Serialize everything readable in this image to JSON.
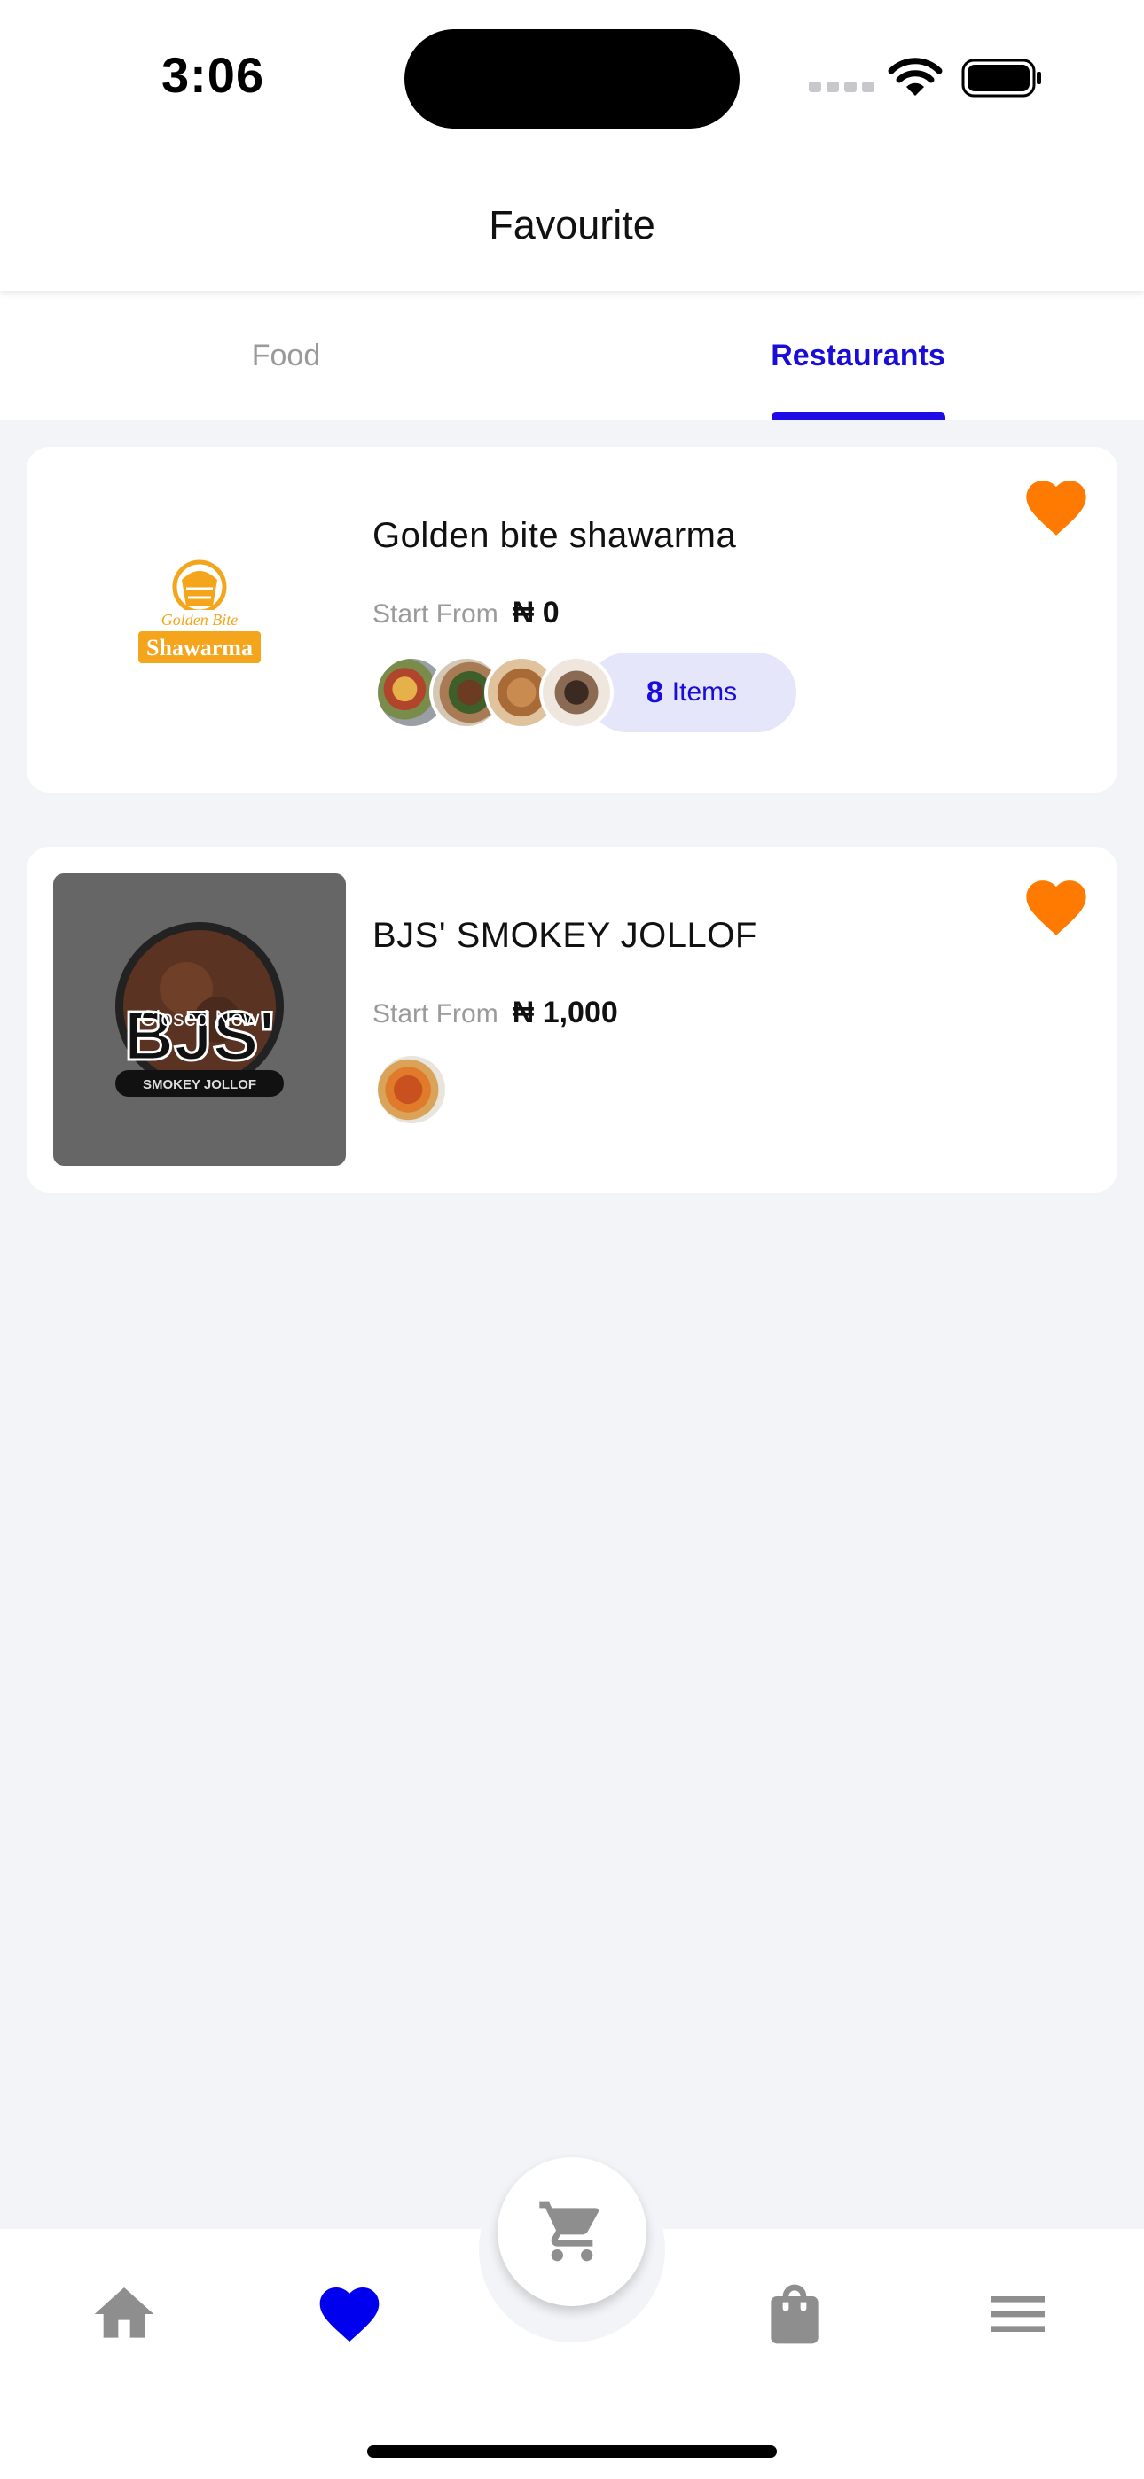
{
  "status_bar": {
    "time": "3:06"
  },
  "header": {
    "title": "Favourite"
  },
  "tabs": [
    {
      "label": "Food",
      "active": false
    },
    {
      "label": "Restaurants",
      "active": true
    }
  ],
  "restaurants": [
    {
      "name": "Golden bite shawarma",
      "start_label": "Start From",
      "price": "₦ 0",
      "logo_text_top": "Golden Bite",
      "logo_text_bottom": "Shawarma",
      "items_count": "8",
      "items_label": "Items",
      "favorited": true
    },
    {
      "name": "BJS' SMOKEY JOLLOF",
      "start_label": "Start From",
      "price": "₦ 1,000",
      "status": "Closed Now",
      "logo_text_main": "BJS'",
      "logo_text_sub": "SMOKEY JOLLOF",
      "favorited": true
    }
  ],
  "bottom_nav": [
    {
      "icon": "home-icon",
      "active": false
    },
    {
      "icon": "heart-icon",
      "active": true
    },
    {
      "icon": "cart-icon",
      "active": false
    },
    {
      "icon": "bag-icon",
      "active": false
    },
    {
      "icon": "menu-icon",
      "active": false
    }
  ],
  "colors": {
    "accent": "#1a0dd8",
    "favorite": "#ff7a00",
    "inactive": "#8e8e8e",
    "background": "#f3f4f7"
  }
}
